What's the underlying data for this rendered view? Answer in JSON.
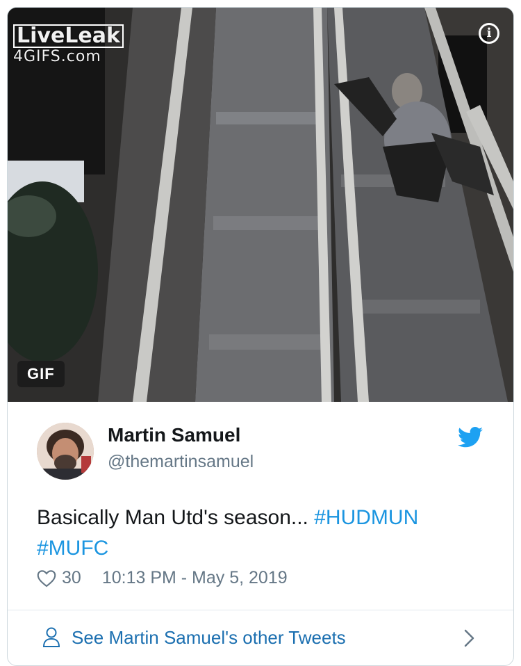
{
  "media": {
    "watermark_line1": "LiveLeak",
    "watermark_line2": "4GIFS.com",
    "badge": "GIF",
    "info_icon": "info-icon"
  },
  "author": {
    "name": "Martin Samuel",
    "handle": "@themartinsamuel"
  },
  "tweet": {
    "text": "Basically Man Utd's season... ",
    "hashtags": [
      "#HUDMUN",
      "#MUFC"
    ]
  },
  "meta": {
    "likes": "30",
    "timestamp": "10:13 PM - May 5, 2019"
  },
  "footer": {
    "more_tweets_label": "See Martin Samuel's other Tweets"
  },
  "colors": {
    "link": "#1b95e0",
    "secondary_text": "#657786",
    "twitter_blue": "#1da1f2"
  }
}
